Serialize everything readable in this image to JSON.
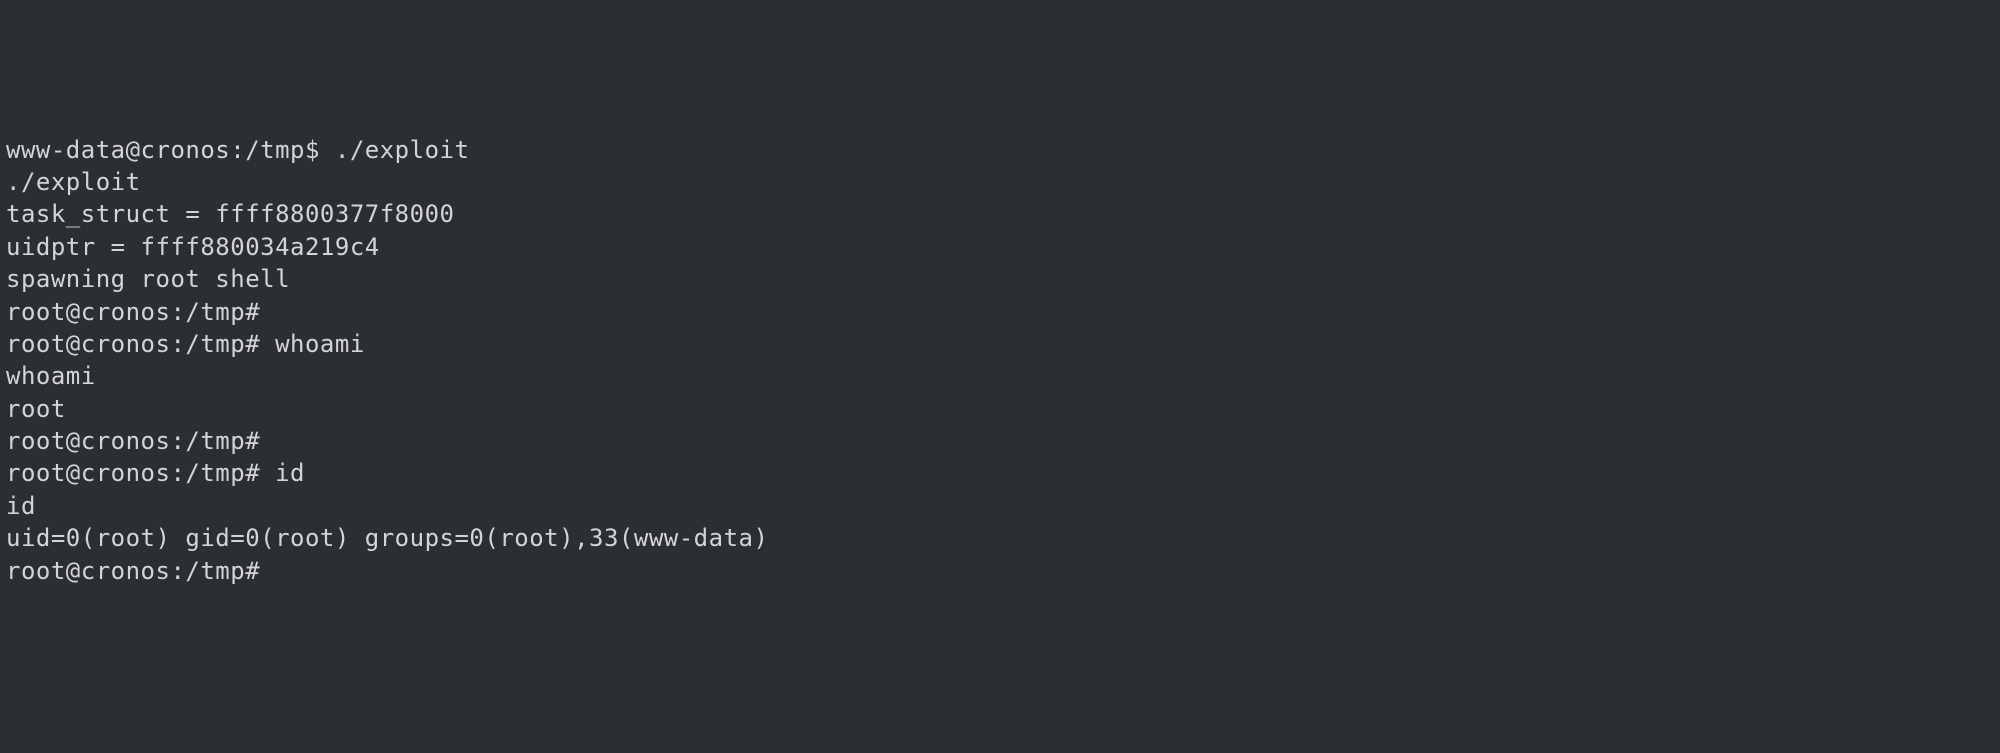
{
  "terminal": {
    "lines": [
      "www-data@cronos:/tmp$ ./exploit",
      "./exploit",
      "task_struct = ffff8800377f8000",
      "uidptr = ffff880034a219c4",
      "spawning root shell",
      "root@cronos:/tmp#",
      "",
      "root@cronos:/tmp# whoami",
      "whoami",
      "root",
      "root@cronos:/tmp#",
      "",
      "root@cronos:/tmp# id",
      "id",
      "uid=0(root) gid=0(root) groups=0(root),33(www-data)",
      "root@cronos:/tmp#"
    ]
  }
}
